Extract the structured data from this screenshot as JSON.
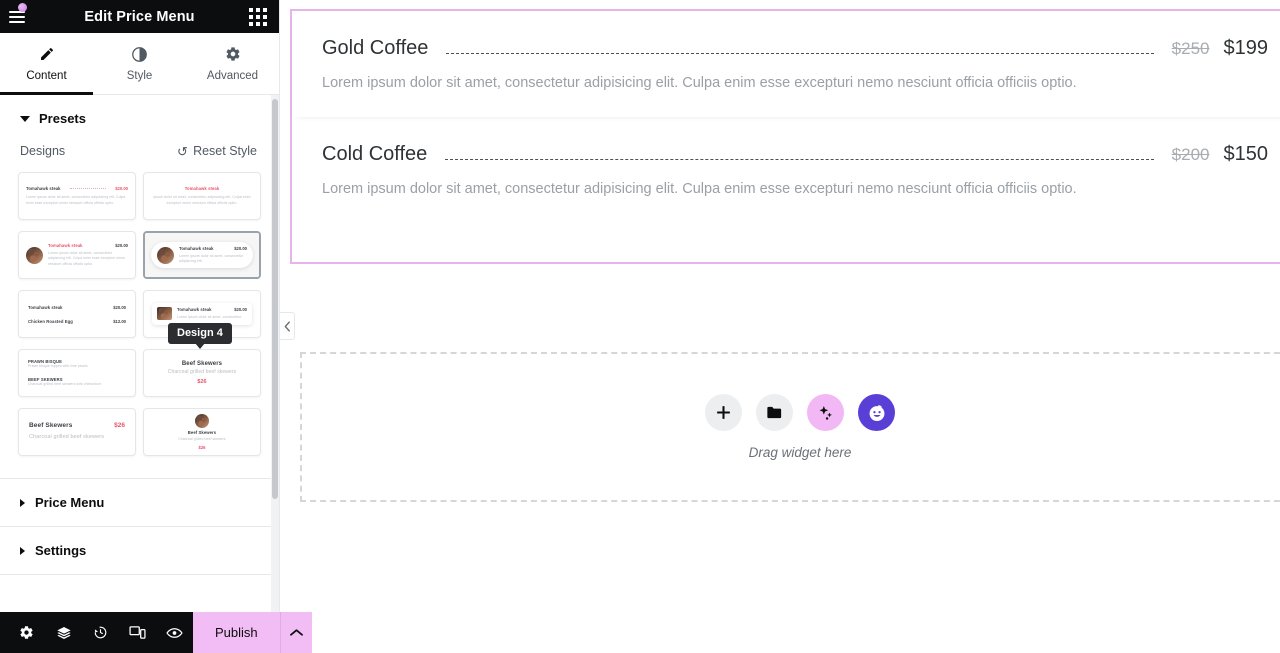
{
  "panel": {
    "title": "Edit Price Menu",
    "menu_icon": "hamburger-icon",
    "apps_icon": "apps-grid-icon",
    "tabs": [
      {
        "label": "Content",
        "icon": "pencil-icon",
        "active": true
      },
      {
        "label": "Style",
        "icon": "contrast-icon",
        "active": false
      },
      {
        "label": "Advanced",
        "icon": "gear-icon",
        "active": false
      }
    ],
    "presets": {
      "title": "Presets",
      "designs_label": "Designs",
      "reset_label": "Reset Style",
      "reset_icon": "reset-icon",
      "tooltip": "Design 4",
      "selected_index": 3,
      "cards": [
        {
          "name": "design-1",
          "sample_title": "Tomahawk steak",
          "sample_price": "$20.00",
          "sample_desc": "Lorem ipsum dolor sit amet, consectetur adipisicing elit. Culpa enim esse excepturi nemo nesciunt officia officiis optio."
        },
        {
          "name": "design-2",
          "sample_title": "Tomahawk steak",
          "sample_desc": "ipsum dolor sit amet, consectetur adipisicing elit. Culpa enim excepturi nemo nesciunt officia officiis optio."
        },
        {
          "name": "design-3",
          "sample_title": "Tomahawk steak",
          "sample_price": "$20.00",
          "sample_desc": "Lorem ipsum dolor sit amet, consectetur adipisicing elit. Culpa enim esse excepturi nemo nesciunt officia officiis optio."
        },
        {
          "name": "design-4",
          "sample_title": "Tomahawk steak",
          "sample_price": "$20.00",
          "sample_desc": "Lorem ipsum dolor sit amet, consectetur adipisicing elit."
        },
        {
          "name": "design-5",
          "sample_title": "Tomahawk steak",
          "sample_price": "$20.00",
          "sample_title2": "Chicken Roasted Egg",
          "sample_price2": "$12.00"
        },
        {
          "name": "design-6",
          "sample_title": "Tomahawk steak",
          "sample_price": "$20.00",
          "sample_desc": "Lorem ipsum dolor sit amet, consectetur."
        },
        {
          "name": "design-7",
          "sample_title": "PRAWN BISQUE",
          "sample_desc": "Prawn bisque topped with lime pearls",
          "sample_title2": "BEEF SKEWERS",
          "sample_desc2": "Charcoal grilled beef skewers with chimichurri"
        },
        {
          "name": "design-8",
          "sample_title": "Beef Skewers",
          "sample_desc": "Charcoal grilled beef skewers",
          "sample_price": "$26"
        },
        {
          "name": "design-9",
          "sample_title": "Beef Skewers",
          "sample_price": "$26",
          "sample_desc": "Charcoal grilled beef skewers"
        },
        {
          "name": "design-10",
          "sample_title": "Beef Skewers",
          "sample_desc": "Charcoal grilled beef skewers",
          "sample_price": "$26"
        }
      ]
    },
    "accordions": [
      {
        "label": "Price Menu"
      },
      {
        "label": "Settings"
      }
    ],
    "footer": {
      "icons": [
        {
          "name": "settings-gear-icon"
        },
        {
          "name": "navigator-layers-icon"
        },
        {
          "name": "history-icon"
        },
        {
          "name": "responsive-mode-icon"
        },
        {
          "name": "preview-eye-icon"
        }
      ],
      "publish_label": "Publish",
      "publish_caret_icon": "chevron-up-icon"
    }
  },
  "canvas": {
    "collapse_icon": "chevron-left-icon",
    "menu_items": [
      {
        "name": "Gold Coffee",
        "old_price": "$250",
        "price": "$199",
        "description": "Lorem ipsum dolor sit amet, consectetur adipisicing elit. Culpa enim esse excepturi nemo nesciunt officia officiis optio."
      },
      {
        "name": "Cold Coffee",
        "old_price": "$200",
        "price": "$150",
        "description": "Lorem ipsum dolor sit amet, consectetur adipisicing elit. Culpa enim esse excepturi nemo nesciunt officia officiis optio."
      }
    ],
    "dropzone": {
      "label": "Drag widget here",
      "buttons": [
        {
          "name": "add-element-button",
          "icon": "plus-icon"
        },
        {
          "name": "add-template-button",
          "icon": "folder-icon"
        },
        {
          "name": "ai-button",
          "icon": "sparkles-icon"
        },
        {
          "name": "assistant-button",
          "icon": "smiley-face-icon"
        }
      ]
    }
  },
  "colors": {
    "accent_pink": "#f2bdf5",
    "selection_border": "#e6b4ea",
    "panel_dark": "#0c0d0e",
    "assist_purple": "#5a3fd6",
    "thumb_pink": "#e8546b"
  }
}
